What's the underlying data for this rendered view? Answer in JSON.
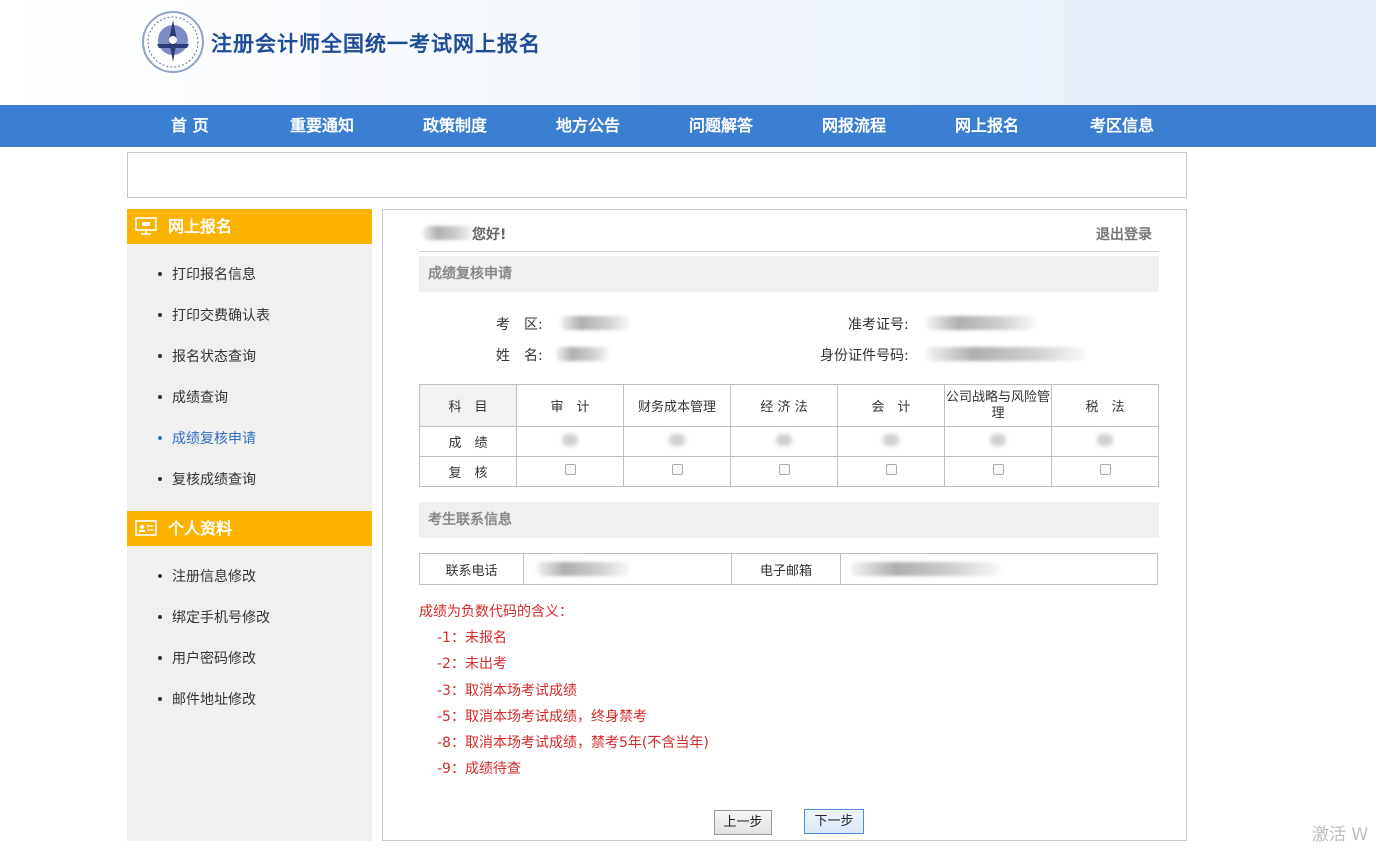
{
  "header": {
    "site_title": "注册会计师全国统一考试网上报名",
    "logo_icon": "cicpa-logo-icon"
  },
  "nav": [
    "首 页",
    "重要通知",
    "政策制度",
    "地方公告",
    "问题解答",
    "网报流程",
    "网上报名",
    "考区信息"
  ],
  "sidebar": {
    "online_signup": {
      "title": "网上报名",
      "icon": "monitor-icon",
      "items": [
        "打印报名信息",
        "打印交费确认表",
        "报名状态查询",
        "成绩查询",
        "成绩复核申请",
        "复核成绩查询"
      ]
    },
    "profile": {
      "title": "个人资料",
      "icon": "id-card-icon",
      "items": [
        "注册信息修改",
        "绑定手机号修改",
        "用户密码修改",
        "邮件地址修改"
      ]
    },
    "active_item": "成绩复核申请"
  },
  "main": {
    "greeting": "您好!",
    "logout": "退出登录",
    "section_review": "成绩复核申请",
    "exam_area_label": "考　区:",
    "name_label": "姓　名:",
    "ticket_label": "准考证号:",
    "id_label": "身份证件号码:",
    "score_table": {
      "col_header": "科　目",
      "subjects": [
        "审　计",
        "财务成本管理",
        "经 济 法",
        "会　计",
        "公司战略与风险管理",
        "税　法"
      ],
      "score_row_label": "成　绩",
      "review_row_label": "复　核"
    },
    "section_contact": "考生联系信息",
    "phone_label": "联系电话",
    "email_label": "电子邮箱",
    "notes_title": "成绩为负数代码的含义：",
    "notes": [
      "-1：未报名",
      "-2：未出考",
      "-3：取消本场考试成绩",
      "-5：取消本场考试成绩，终身禁考",
      "-8：取消本场考试成绩，禁考5年(不含当年)",
      "-9：成绩待查"
    ],
    "prev_button": "上一步",
    "next_button": "下一步"
  },
  "watermark": "激活 W",
  "colors": {
    "nav_bg": "#3a7fd1",
    "sidebar_head": "#fcb300",
    "notes_red": "#d42a2a",
    "title_blue": "#1f4d96"
  }
}
